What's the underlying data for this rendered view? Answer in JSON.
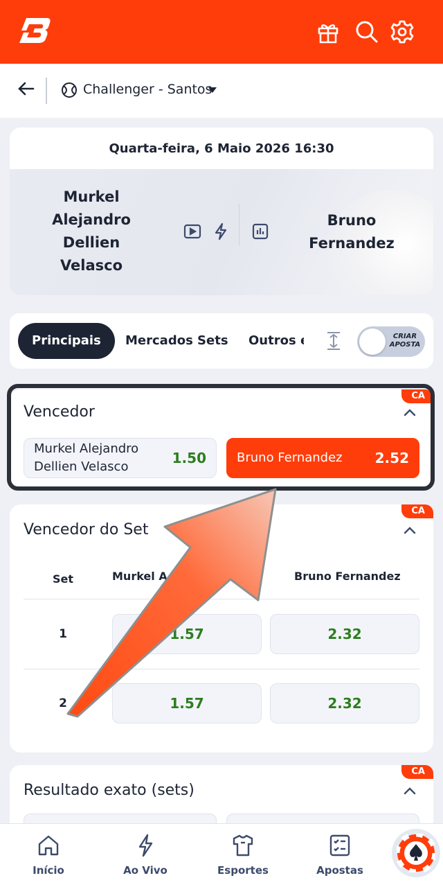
{
  "header": {
    "logo": "brand-b-logo",
    "icons": [
      "gift-icon",
      "search-icon",
      "gear-icon"
    ]
  },
  "nav": {
    "tournament": "Challenger - Santos"
  },
  "match": {
    "datetime": "Quarta-feira, 6 Maio 2026 16:30",
    "player1_lines": [
      "Murkel",
      "Alejandro",
      "Dellien",
      "Velasco"
    ],
    "player2_lines": [
      "Bruno",
      "Fernandez"
    ]
  },
  "tabs": {
    "items": [
      "Principais",
      "Mercados Sets",
      "Outros e"
    ],
    "active": "Principais",
    "toggle_lines": [
      "CRIAR",
      "APOSTA"
    ]
  },
  "badge": "CA",
  "markets": {
    "winner": {
      "title": "Vencedor",
      "option1_lines": [
        "Murkel Alejandro",
        "Dellien Velasco"
      ],
      "option1_odd": "1.50",
      "option2_name": "Bruno Fernandez",
      "option2_odd": "2.52",
      "selected": "option2"
    },
    "set_winner": {
      "title": "Vencedor do Set",
      "col_set": "Set",
      "col_p1": "Murkel A",
      "col_p1_tail": ".",
      "col_p2": "Bruno Fernandez",
      "rows": [
        {
          "set": "1",
          "p1": "1.57",
          "p2": "2.32"
        },
        {
          "set": "2",
          "p1": "1.57",
          "p2": "2.32"
        }
      ]
    },
    "exact_result": {
      "title": "Resultado exato (sets)"
    }
  },
  "bottom_nav": {
    "items": [
      "Início",
      "Ao Vivo",
      "Esportes",
      "Apostas"
    ]
  },
  "colors": {
    "brand": "#ff3d0a",
    "odd_green": "#2e7d1f",
    "dark": "#1d2433"
  }
}
